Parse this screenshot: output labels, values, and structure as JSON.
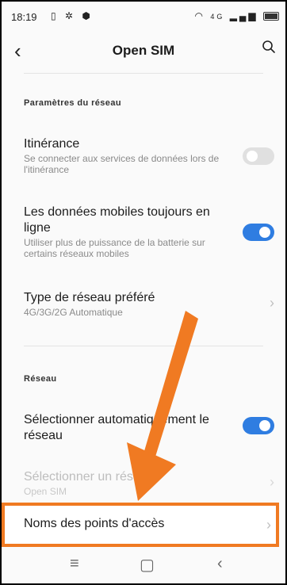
{
  "status": {
    "time": "18:19",
    "network": "4G"
  },
  "appbar": {
    "title": "Open SIM"
  },
  "sections": [
    {
      "title": "Paramètres du réseau"
    },
    {
      "title": "Réseau"
    }
  ],
  "items": [
    {
      "title": "Itinérance",
      "subtitle": "Se connecter aux services de données lors de l'itinérance"
    },
    {
      "title": "Les données mobiles toujours en ligne",
      "subtitle": "Utiliser plus de puissance de la batterie sur certains réseaux mobiles"
    },
    {
      "title": "Type de réseau préféré",
      "subtitle": "4G/3G/2G Automatique"
    },
    {
      "title": "Sélectionner automatiquement le réseau",
      "subtitle": ""
    },
    {
      "title": "Sélectionner un réseau",
      "subtitle": "Open SIM"
    },
    {
      "title": "Noms des points d'accès",
      "subtitle": ""
    }
  ],
  "colors": {
    "accent": "#2f7de1",
    "highlight": "#f07a22"
  }
}
